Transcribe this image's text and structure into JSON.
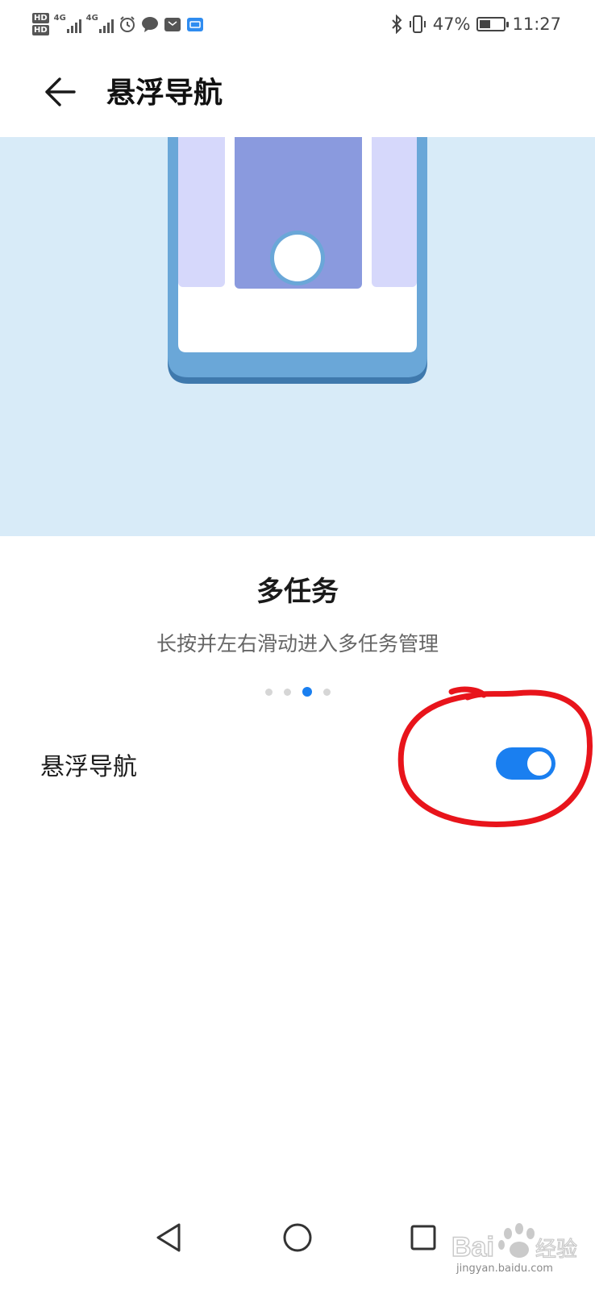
{
  "status_bar": {
    "sim1_label": "HD",
    "sim2_label": "HD",
    "network1": "4G",
    "network2": "4G",
    "battery_percent": "47%",
    "battery_level": 0.47,
    "time": "11:27",
    "icons": [
      "hd-icon",
      "signal-icon",
      "alarm-icon",
      "message-icon",
      "huawei-icon",
      "cast-icon",
      "bluetooth-icon",
      "vibrate-icon",
      "battery-icon"
    ]
  },
  "header": {
    "back_icon": "arrow-left-icon",
    "title": "悬浮导航"
  },
  "feature": {
    "title": "多任务",
    "description": "长按并左右滑动进入多任务管理"
  },
  "pager": {
    "count": 4,
    "active_index": 2
  },
  "setting": {
    "label": "悬浮导航",
    "enabled": true
  },
  "nav_bar": {
    "icons": [
      "back-triangle-icon",
      "home-circle-icon",
      "recents-square-icon"
    ]
  },
  "colors": {
    "accent": "#1a7ff0",
    "illustration_bg": "#d8ebf8",
    "phone_frame": "#6aa7d8",
    "center_card": "#8a9ade",
    "side_card": "#d6d8fb",
    "annotation": "#e8141b"
  },
  "watermark": {
    "brand": "Baidu经验",
    "url": "jingyan.baidu.com"
  }
}
